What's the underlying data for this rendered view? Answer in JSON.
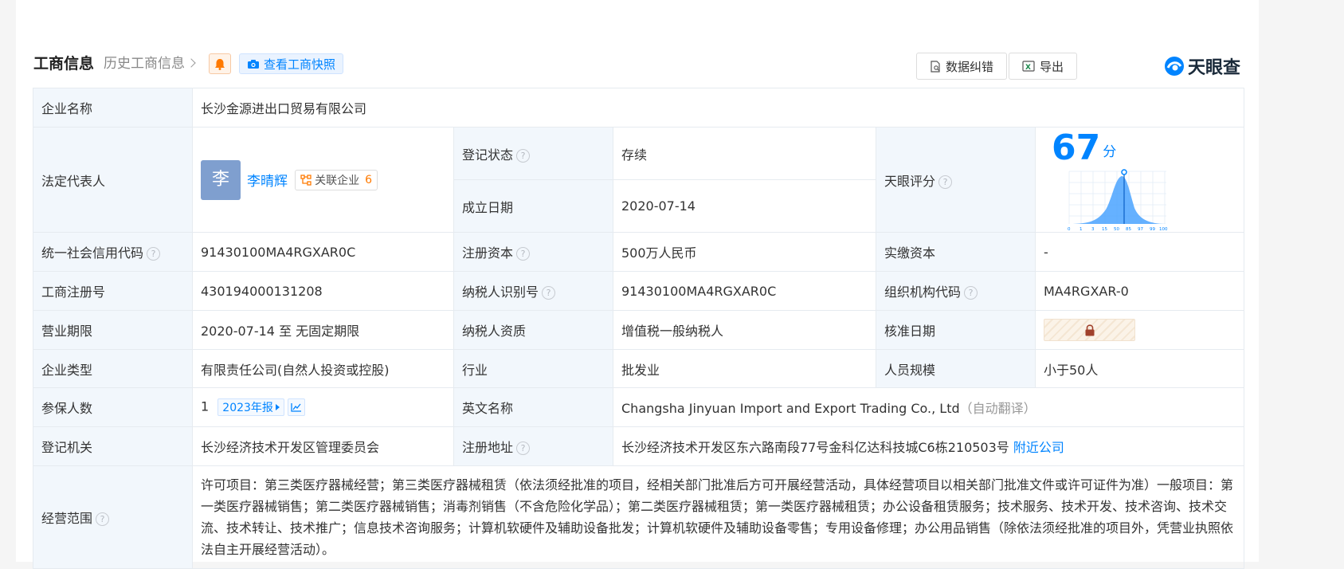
{
  "header": {
    "title": "工商信息",
    "history_link": "历史工商信息",
    "snapshot_button": "查看工商快照",
    "correct_button": "数据纠错",
    "export_button": "导出",
    "logo_text": "天眼查"
  },
  "rows": {
    "company_name_label": "企业名称",
    "company_name": "长沙金源进出口贸易有限公司",
    "legal_rep_label": "法定代表人",
    "legal_rep_avatar": "李",
    "legal_rep_name": "李晴辉",
    "related_label": "关联企业",
    "related_count": "6",
    "reg_status_label": "登记状态",
    "reg_status": "存续",
    "found_date_label": "成立日期",
    "found_date": "2020-07-14",
    "score_label": "天眼评分",
    "score_value": "67",
    "score_unit": "分",
    "score_axis": [
      "0",
      "1",
      "3",
      "15",
      "50",
      "85",
      "97",
      "99",
      "100"
    ],
    "credit_code_label": "统一社会信用代码",
    "credit_code": "91430100MA4RGXAR0C",
    "reg_capital_label": "注册资本",
    "reg_capital": "500万人民币",
    "paid_capital_label": "实缴资本",
    "paid_capital": "-",
    "reg_no_label": "工商注册号",
    "reg_no": "430194000131208",
    "taxpayer_id_label": "纳税人识别号",
    "taxpayer_id": "91430100MA4RGXAR0C",
    "org_code_label": "组织机构代码",
    "org_code": "MA4RGXAR-0",
    "term_label": "营业期限",
    "term": "2020-07-14 至 无固定期限",
    "taxpayer_qual_label": "纳税人资质",
    "taxpayer_qual": "增值税一般纳税人",
    "approve_date_label": "核准日期",
    "company_type_label": "企业类型",
    "company_type": "有限责任公司(自然人投资或控股)",
    "industry_label": "行业",
    "industry": "批发业",
    "staff_size_label": "人员规模",
    "staff_size": "小于50人",
    "insured_label": "参保人数",
    "insured_count": "1",
    "insured_report": "2023年报",
    "english_name_label": "英文名称",
    "english_name": "Changsha Jinyuan Import and Export Trading Co., Ltd",
    "english_name_note": "（自动翻译）",
    "authority_label": "登记机关",
    "authority": "长沙经济技术开发区管理委员会",
    "address_label": "注册地址",
    "address": "长沙经济技术开发区东六路南段77号金科亿达科技城C6栋210503号",
    "nearby_link": "附近公司",
    "scope_label": "经营范围",
    "scope": "许可项目：第三类医疗器械经营；第三类医疗器械租赁（依法须经批准的项目，经相关部门批准后方可开展经营活动，具体经营项目以相关部门批准文件或许可证件为准）一般项目：第一类医疗器械销售；第二类医疗器械销售；消毒剂销售（不含危险化学品）；第二类医疗器械租赁；第一类医疗器械租赁；办公设备租赁服务；技术服务、技术开发、技术咨询、技术交流、技术转让、技术推广；信息技术咨询服务；计算机软硬件及辅助设备批发；计算机软硬件及辅助设备零售；专用设备修理；办公用品销售（除依法须经批准的项目外，凭营业执照依法自主开展经营活动）。"
  },
  "icons": {
    "bell": "bell-icon",
    "camera": "camera-icon",
    "correct": "document-edit-icon",
    "export": "excel-icon",
    "lock": "lock-icon",
    "help": "question-icon",
    "trend": "trend-chart-icon"
  },
  "colors": {
    "accent": "#0084ff",
    "status_green": "#00a870",
    "label_bg": "#f2f7fc",
    "badge_orange": "#ff7a00"
  }
}
